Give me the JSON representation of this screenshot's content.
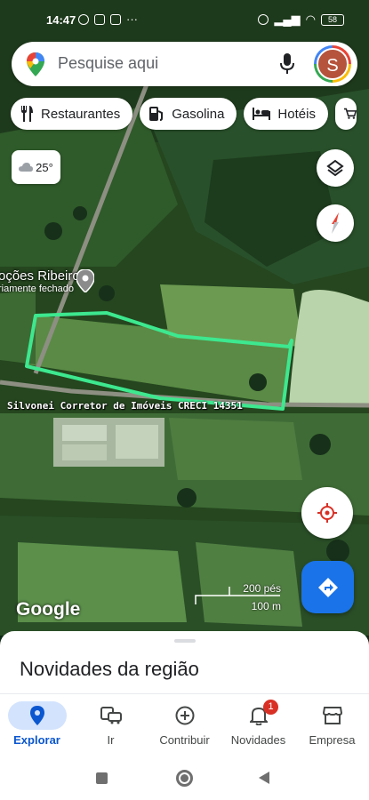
{
  "status_bar": {
    "time": "14:47",
    "battery": "58"
  },
  "search": {
    "placeholder": "Pesquise aqui",
    "avatar_letter": "S"
  },
  "chips": [
    {
      "icon": "fork-knife-icon",
      "label": "Restaurantes"
    },
    {
      "icon": "gas-station-icon",
      "label": "Gasolina"
    },
    {
      "icon": "bed-icon",
      "label": "Hotéis"
    },
    {
      "icon": "cart-icon",
      "label": ""
    }
  ],
  "weather": {
    "temp": "25°",
    "icon": "cloud-icon"
  },
  "map": {
    "place_name": "oções Ribeiro",
    "place_status": "riamente fechado",
    "watermark": "Silvonei Corretor de Imóveis CRECI 14351",
    "logo": "Google",
    "scale_ft": "200 pés",
    "scale_m": "100 m",
    "boundary_color": "#3de88f"
  },
  "sheet": {
    "title": "Novidades da região"
  },
  "bottom_nav": [
    {
      "label": "Explorar",
      "icon": "explore-pin-icon",
      "active": true
    },
    {
      "label": "Ir",
      "icon": "commute-icon"
    },
    {
      "label": "Contribuir",
      "icon": "add-circle-icon"
    },
    {
      "label": "Novidades",
      "icon": "bell-icon",
      "badge": "1"
    },
    {
      "label": "Empresa",
      "icon": "storefront-icon"
    }
  ],
  "colors": {
    "accent": "#1a73e8",
    "active_pill": "#d3e3fd",
    "badge": "#d93025"
  }
}
